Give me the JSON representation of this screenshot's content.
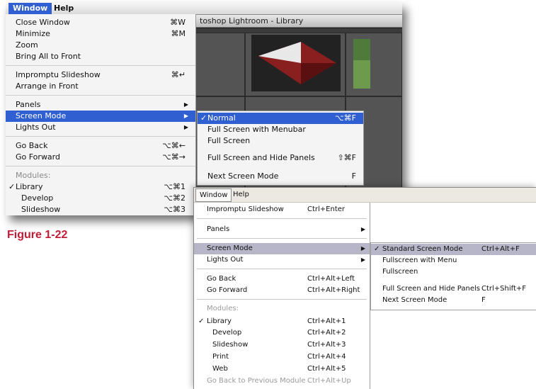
{
  "mac": {
    "menubar": {
      "window": "Window",
      "help": "Help"
    },
    "app_title": "toshop Lightroom - Library",
    "window_menu": {
      "close_window": {
        "label": "Close Window",
        "shortcut": "⌘W"
      },
      "minimize": {
        "label": "Minimize",
        "shortcut": "⌘M"
      },
      "zoom": {
        "label": "Zoom"
      },
      "bring_all_to_front": {
        "label": "Bring All to Front"
      },
      "impromptu_slideshow": {
        "label": "Impromptu Slideshow",
        "shortcut": "⌘↵"
      },
      "arrange_in_front": {
        "label": "Arrange in Front"
      },
      "panels": {
        "label": "Panels"
      },
      "screen_mode": {
        "label": "Screen Mode"
      },
      "lights_out": {
        "label": "Lights Out"
      },
      "go_back": {
        "label": "Go Back",
        "shortcut": "⌥⌘←"
      },
      "go_forward": {
        "label": "Go Forward",
        "shortcut": "⌥⌘→"
      },
      "modules_header": "Modules:",
      "library": {
        "label": "Library",
        "shortcut": "⌥⌘1"
      },
      "develop": {
        "label": "Develop",
        "shortcut": "⌥⌘2"
      },
      "slideshow": {
        "label": "Slideshow",
        "shortcut": "⌥⌘3"
      }
    },
    "screen_mode_submenu": {
      "normal": {
        "label": "Normal",
        "shortcut": "⌥⌘F"
      },
      "full_screen_menubar": {
        "label": "Full Screen with Menubar"
      },
      "full_screen": {
        "label": "Full Screen"
      },
      "full_screen_hide_panels": {
        "label": "Full Screen and Hide Panels",
        "shortcut": "⇧⌘F"
      },
      "next_screen_mode": {
        "label": "Next Screen Mode",
        "shortcut": "F"
      }
    }
  },
  "figure_label": "Figure 1-22",
  "win": {
    "menubar": {
      "window": "Window",
      "help": "Help"
    },
    "window_menu": {
      "impromptu_slideshow": {
        "label": "Impromptu Slideshow",
        "shortcut": "Ctrl+Enter"
      },
      "panels": {
        "label": "Panels"
      },
      "screen_mode": {
        "label": "Screen Mode"
      },
      "lights_out": {
        "label": "Lights Out"
      },
      "go_back": {
        "label": "Go Back",
        "shortcut": "Ctrl+Alt+Left"
      },
      "go_forward": {
        "label": "Go Forward",
        "shortcut": "Ctrl+Alt+Right"
      },
      "modules_header": "Modules:",
      "library": {
        "label": "Library",
        "shortcut": "Ctrl+Alt+1"
      },
      "develop": {
        "label": "Develop",
        "shortcut": "Ctrl+Alt+2"
      },
      "slideshow": {
        "label": "Slideshow",
        "shortcut": "Ctrl+Alt+3"
      },
      "print": {
        "label": "Print",
        "shortcut": "Ctrl+Alt+4"
      },
      "web": {
        "label": "Web",
        "shortcut": "Ctrl+Alt+5"
      },
      "go_back_previous_module": {
        "label": "Go Back to Previous Module",
        "shortcut": "Ctrl+Alt+Up"
      }
    },
    "screen_mode_submenu": {
      "standard": {
        "label": "Standard Screen Mode",
        "shortcut": "Ctrl+Alt+F"
      },
      "fullscreen_menu": {
        "label": "Fullscreen with Menu"
      },
      "fullscreen": {
        "label": "Fullscreen"
      },
      "full_screen_hide_panels": {
        "label": "Full Screen and Hide Panels",
        "shortcut": "Ctrl+Shift+F"
      },
      "next_screen_mode": {
        "label": "Next Screen Mode",
        "shortcut": "F"
      }
    }
  },
  "glyphs": {
    "check": "✓",
    "submenu_arrow": "▶"
  },
  "colors": {
    "mac_highlight": "#2f5fd0",
    "win_highlight": "#b6b6c8",
    "figure_label": "#c21d37"
  }
}
